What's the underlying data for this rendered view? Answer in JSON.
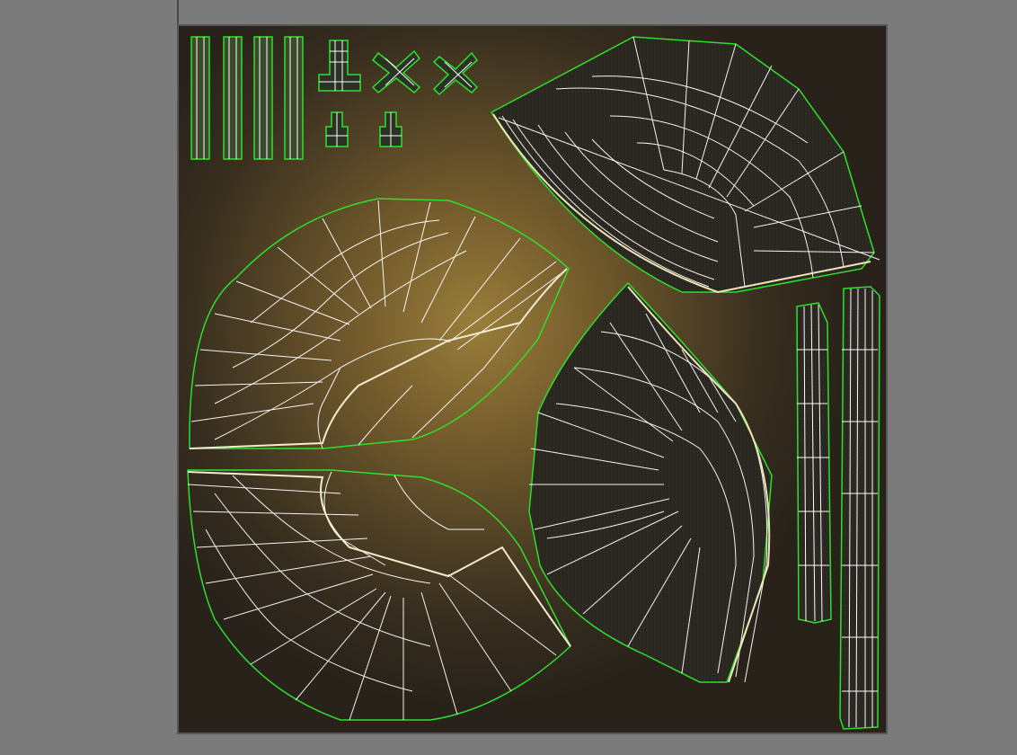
{
  "window": {
    "background_color": "#7b7b7b"
  },
  "uv_canvas": {
    "texture_colors": [
      "#a08a3c",
      "#2a2620"
    ],
    "wire_color": "#ffffff",
    "seam_color": "#2de02d"
  },
  "uv_islands": [
    {
      "name": "strip-1"
    },
    {
      "name": "strip-2"
    },
    {
      "name": "strip-3"
    },
    {
      "name": "strip-4"
    },
    {
      "name": "small-t-piece"
    },
    {
      "name": "small-cross-1"
    },
    {
      "name": "small-cross-2"
    },
    {
      "name": "small-tab-1"
    },
    {
      "name": "small-tab-2"
    },
    {
      "name": "fan-top-right"
    },
    {
      "name": "fan-left-upper"
    },
    {
      "name": "fan-left-lower"
    },
    {
      "name": "fan-center"
    },
    {
      "name": "strip-right-1"
    },
    {
      "name": "strip-right-2"
    }
  ]
}
